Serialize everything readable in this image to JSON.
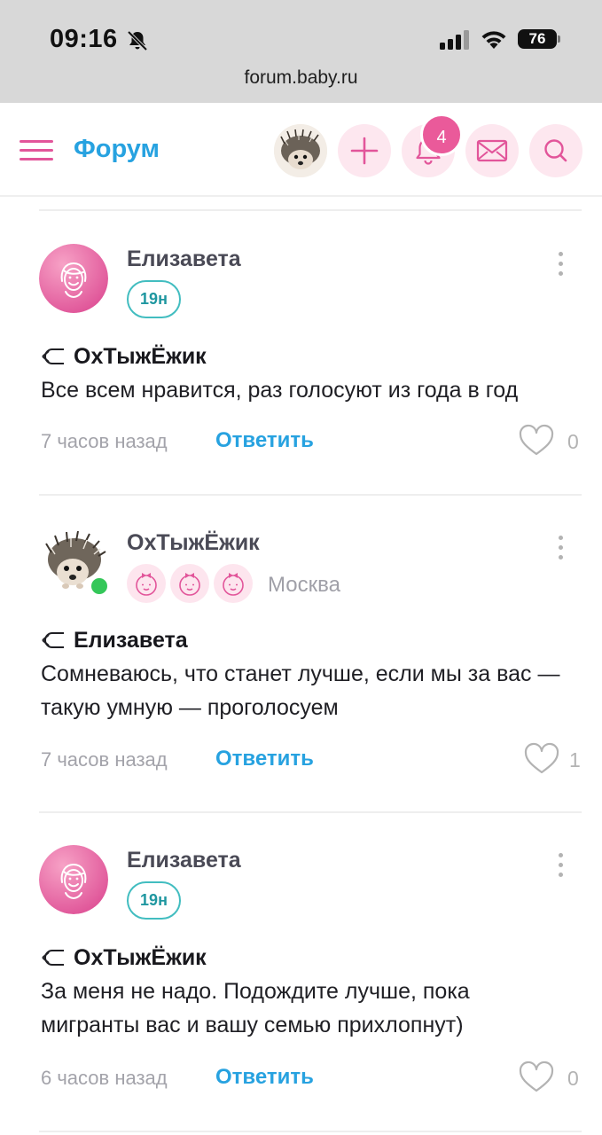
{
  "status_bar": {
    "time": "09:16",
    "battery": "76"
  },
  "browser": {
    "url": "forum.baby.ru"
  },
  "header": {
    "title": "Форум",
    "notifications_count": "4"
  },
  "comments": [
    {
      "author": "Елизавета",
      "badge": "19н",
      "reply_to": "ОхТыжЁжик",
      "text": "Все всем нравится, раз голосуют из года в год",
      "time": "7 часов назад",
      "reply_label": "Ответить",
      "likes": "0"
    },
    {
      "author": "ОхТыжЁжик",
      "city": "Москва",
      "reply_to": "Елизавета",
      "text": "Сомневаюсь, что станет лучше, если мы за вас — такую умную — проголосуем",
      "time": "7 часов назад",
      "reply_label": "Ответить",
      "likes": "1"
    },
    {
      "author": "Елизавета",
      "badge": "19н",
      "reply_to": "ОхТыжЁжик",
      "text": "За меня не надо. Подождите лучше, пока мигранты вас и вашу семью прихлопнут)",
      "time": "6 часов назад",
      "reply_label": "Ответить",
      "likes": "0"
    }
  ],
  "colors": {
    "accent_blue": "#27a2e0",
    "accent_pink": "#e2559a",
    "online_green": "#34c759",
    "badge_teal": "#42bdc0"
  }
}
